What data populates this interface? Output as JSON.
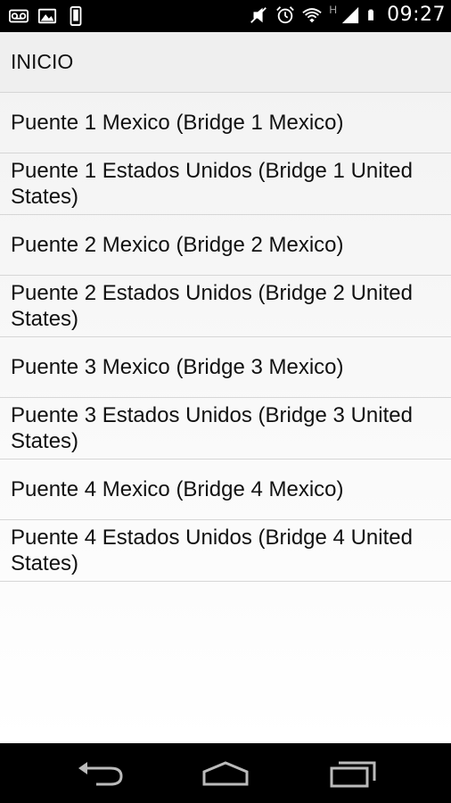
{
  "status_bar": {
    "time": "09:27",
    "network_label": "H",
    "icons": [
      "voicemail-icon",
      "image-icon",
      "phone-icon",
      "mute-icon",
      "alarm-icon",
      "wifi-icon",
      "signal-icon",
      "battery-icon"
    ]
  },
  "header": {
    "title": "INICIO"
  },
  "items": [
    {
      "label": "Puente 1 Mexico (Bridge 1 Mexico)"
    },
    {
      "label": "Puente 1 Estados Unidos (Bridge 1 United States)"
    },
    {
      "label": "Puente 2 Mexico (Bridge 2 Mexico)"
    },
    {
      "label": "Puente 2 Estados Unidos (Bridge 2 United States)"
    },
    {
      "label": "Puente 3 Mexico (Bridge 3 Mexico)"
    },
    {
      "label": "Puente 3 Estados Unidos (Bridge 3 United States)"
    },
    {
      "label": "Puente 4 Mexico (Bridge 4 Mexico)"
    },
    {
      "label": "Puente 4 Estados Unidos (Bridge 4 United States)"
    }
  ],
  "navigation": {
    "buttons": [
      "back-icon",
      "home-icon",
      "recent-apps-icon"
    ]
  }
}
